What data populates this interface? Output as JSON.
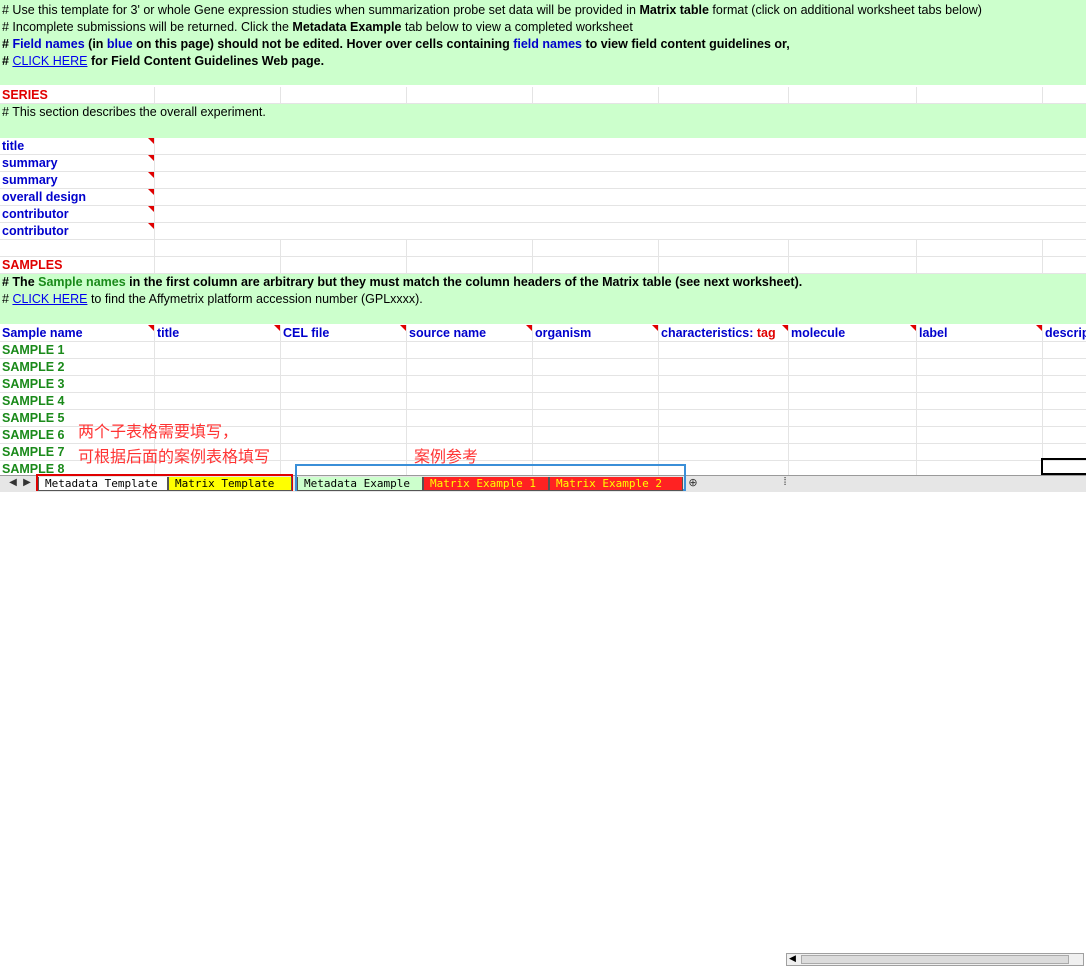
{
  "intro": {
    "line1_a": "# Use this template for 3' or whole Gene expression studies when summarization probe set data will be provided in ",
    "line1_b": "Matrix table",
    "line1_c": " format (click on additional worksheet tabs below)",
    "line2_a": "# Incomplete submissions will be returned. Click the ",
    "line2_b": "Metadata Example",
    "line2_c": " tab below to view a completed worksheet",
    "line3_a": "# ",
    "line3_b": "Field names",
    "line3_c": " (in ",
    "line3_d": "blue",
    "line3_e": " on this page) should not be edited. Hover over cells containing ",
    "line3_f": "field names",
    "line3_g": " to view field content guidelines or,",
    "line4_a": "# ",
    "line4_link": "CLICK HERE",
    "line4_b": " for Field Content Guidelines Web page."
  },
  "series": {
    "heading": "SERIES",
    "description": "# This section describes the overall experiment.",
    "fields": [
      "title",
      "summary",
      "summary",
      "overall design",
      "contributor",
      "contributor"
    ]
  },
  "samples": {
    "heading": "SAMPLES",
    "note_a": "# The ",
    "note_b": "Sample names",
    "note_c": " in the first column are arbitrary but they must match the column headers of the Matrix table (see next worksheet).",
    "note2_a": "# ",
    "note2_link": "CLICK HERE",
    "note2_b": " to find the Affymetrix platform accession number (GPLxxxx).",
    "columns": [
      "Sample name",
      "title",
      "CEL file",
      "source name",
      "organism",
      "characteristics: ",
      "molecule",
      "label",
      "descrip"
    ],
    "characteristics_tag": "tag",
    "rows": [
      "SAMPLE 1",
      "SAMPLE 2",
      "SAMPLE 3",
      "SAMPLE 4",
      "SAMPLE 5",
      "SAMPLE 6",
      "SAMPLE 7",
      "SAMPLE 8"
    ]
  },
  "annotations": {
    "note1": "两个子表格需要填写，",
    "note2": "可根据后面的案例表格填写",
    "note3": "案例参考"
  },
  "tabs": [
    "Metadata Template",
    "Matrix Template",
    "Metadata Example",
    "Matrix Example 1",
    "Matrix Example 2"
  ],
  "colors": {
    "green_fill": "#ccffcc",
    "field_blue": "#0000cc",
    "heading_red": "#e00000",
    "sample_green": "#1a8a1a"
  }
}
